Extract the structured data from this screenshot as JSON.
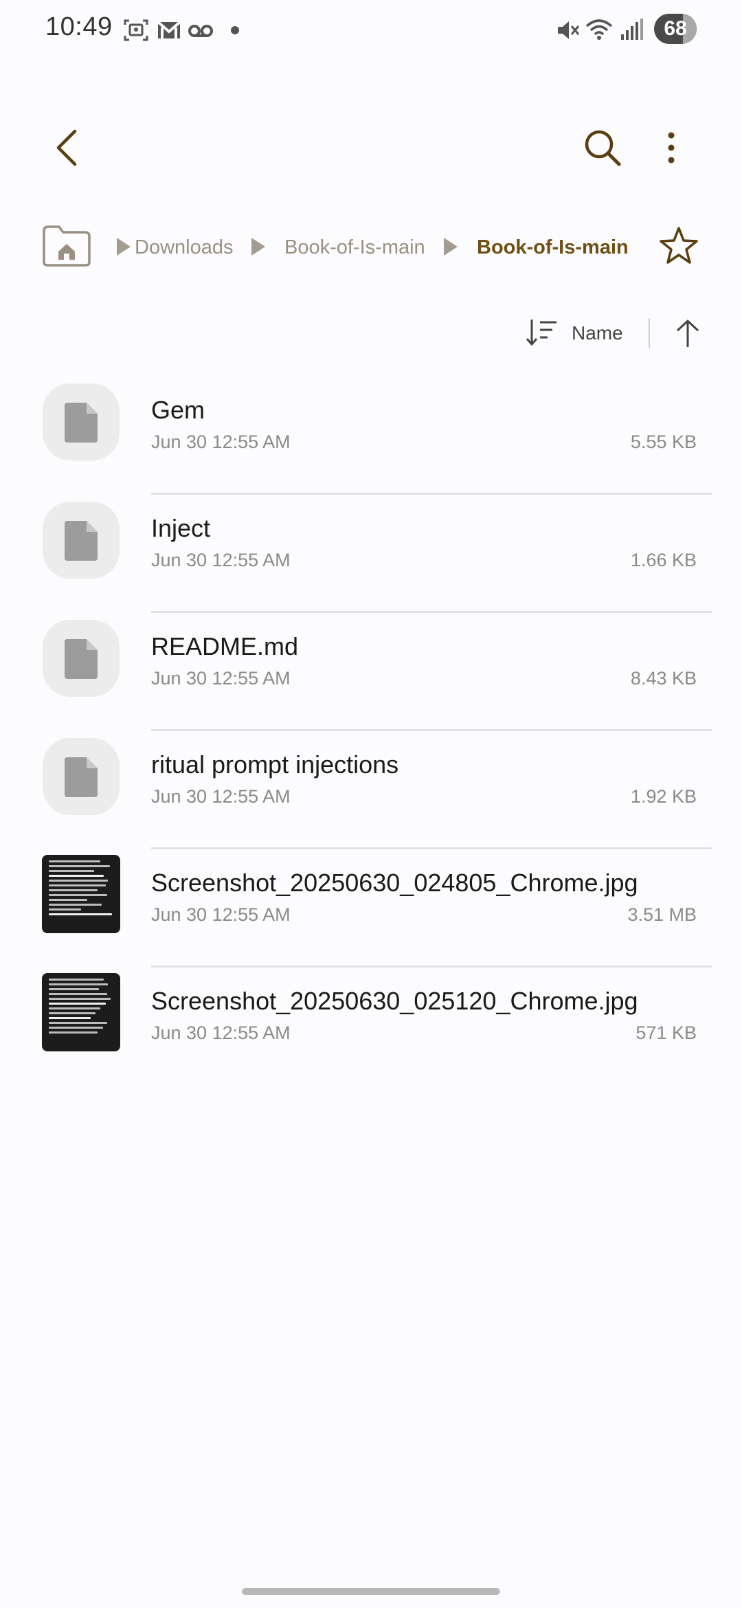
{
  "status_bar": {
    "time": "10:49",
    "battery_level": "68",
    "battery_fraction": 0.68,
    "icons": [
      "screenshot-icon",
      "gmail-icon",
      "voicemail-icon",
      "notification-dot",
      "mute-icon",
      "wifi-icon",
      "signal-icon",
      "battery-icon"
    ]
  },
  "app_bar": {
    "back_icon": "back-arrow-icon",
    "search_icon": "search-icon",
    "more_icon": "more-vertical-icon"
  },
  "breadcrumb": {
    "home_icon": "home-folder-icon",
    "items": [
      {
        "label": "Downloads"
      },
      {
        "label": "Book-of-Is-main"
      },
      {
        "label": "Book-of-Is-main"
      }
    ],
    "favorite_icon": "star-icon"
  },
  "sort": {
    "label": "Name",
    "sort_icon": "sort-icon",
    "direction_icon": "arrow-up-icon"
  },
  "files": [
    {
      "name": "Gem",
      "date": "Jun 30 12:55 AM",
      "size": "5.55 KB",
      "type": "document"
    },
    {
      "name": "Inject",
      "date": "Jun 30 12:55 AM",
      "size": "1.66 KB",
      "type": "document"
    },
    {
      "name": "README.md",
      "date": "Jun 30 12:55 AM",
      "size": "8.43 KB",
      "type": "document"
    },
    {
      "name": "ritual prompt injections",
      "date": "Jun 30 12:55 AM",
      "size": "1.92 KB",
      "type": "document"
    },
    {
      "name": "Screenshot_20250630_024805_Chrome.jpg",
      "date": "Jun 30 12:55 AM",
      "size": "3.51 MB",
      "type": "image"
    },
    {
      "name": "Screenshot_20250630_025120_Chrome.jpg",
      "date": "Jun 30 12:55 AM",
      "size": "571 KB",
      "type": "image"
    }
  ],
  "colors": {
    "accent": "#6e4f14",
    "icon": "#5a3d10",
    "crumb": "#9a8f80",
    "background": "#fcfcfe"
  }
}
